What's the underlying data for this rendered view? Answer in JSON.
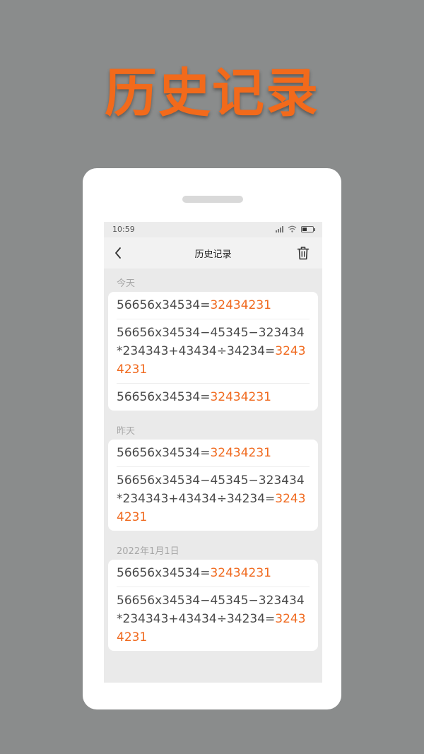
{
  "hero_title": "历史记录",
  "status_bar": {
    "time": "10:59"
  },
  "nav": {
    "title": "历史记录",
    "back_icon": "chevron-left-icon",
    "delete_icon": "trash-icon"
  },
  "colors": {
    "accent": "#f06a1f",
    "background": "#8a8c8c"
  },
  "sections": [
    {
      "label": "今天",
      "entries": [
        {
          "expression": "56656x34534=",
          "result": "32434231"
        },
        {
          "expression": "56656x34534−45345−323434 *234343+43434÷34234=",
          "result": "32434231"
        },
        {
          "expression": "56656x34534=",
          "result": "32434231"
        }
      ]
    },
    {
      "label": "昨天",
      "entries": [
        {
          "expression": "56656x34534=",
          "result": "32434231"
        },
        {
          "expression": "56656x34534−45345−323434 *234343+43434÷34234=",
          "result": "32434231"
        }
      ]
    },
    {
      "label": "2022年1月1日",
      "entries": [
        {
          "expression": "56656x34534=",
          "result": "32434231"
        },
        {
          "expression": "56656x34534−45345−323434 *234343+43434÷34234=",
          "result": "32434231"
        }
      ]
    }
  ]
}
